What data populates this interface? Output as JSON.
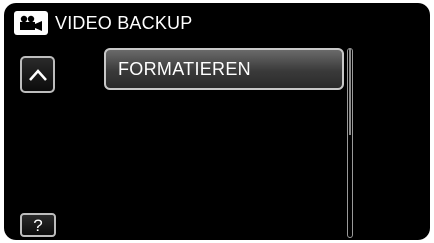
{
  "header": {
    "mode_icon": "video-camera-icon",
    "title": "VIDEO BACKUP"
  },
  "nav": {
    "up_icon": "chevron-up-icon"
  },
  "menu": {
    "items": [
      {
        "label": "FORMATIEREN"
      }
    ]
  },
  "help": {
    "label": "?"
  },
  "colors": {
    "background": "#000000",
    "text": "#ffffff",
    "border": "#bdbdbd"
  }
}
